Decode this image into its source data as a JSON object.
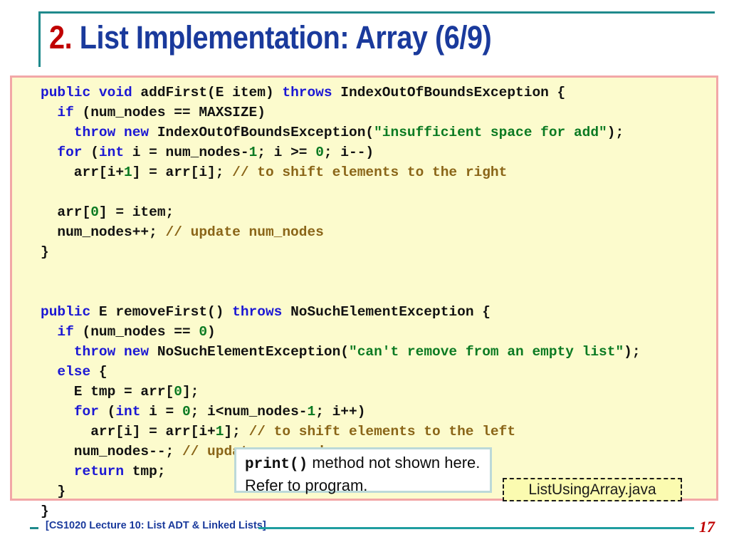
{
  "slide": {
    "title_number": "2.",
    "title_rest": " List Implementation: Array (6/9)",
    "title_accent_color": "#c00000",
    "title_color": "#1a3a9c",
    "title_border_color": "#1f8a8c",
    "page_number": "17"
  },
  "footer": {
    "text": "[CS1020 Lecture 10: List ADT & Linked Lists]",
    "rule_color": "#1f9da0",
    "text_color": "#1a3a9c"
  },
  "code_panel": {
    "background_color": "#fcfbcd",
    "border_color": "#f2a7a7",
    "language": "java",
    "syntax_colors": {
      "keyword": "#1b17d4",
      "number": "#0b7a22",
      "string": "#0b7a22",
      "comment": "#8a6518",
      "plain": "#111111"
    },
    "lines": [
      [
        {
          "t": "kw",
          "s": "public void"
        },
        {
          "t": "pln",
          "s": " addFirst(E item) "
        },
        {
          "t": "kw",
          "s": "throws"
        },
        {
          "t": "pln",
          "s": " IndexOutOfBoundsException {"
        }
      ],
      [
        {
          "t": "pln",
          "s": "  "
        },
        {
          "t": "kw",
          "s": "if"
        },
        {
          "t": "pln",
          "s": " (num_nodes == MAXSIZE)"
        }
      ],
      [
        {
          "t": "pln",
          "s": "    "
        },
        {
          "t": "kw",
          "s": "throw new"
        },
        {
          "t": "pln",
          "s": " IndexOutOfBoundsException("
        },
        {
          "t": "str",
          "s": "\"insufficient space for add\""
        },
        {
          "t": "pln",
          "s": ");"
        }
      ],
      [
        {
          "t": "pln",
          "s": "  "
        },
        {
          "t": "kw",
          "s": "for"
        },
        {
          "t": "pln",
          "s": " ("
        },
        {
          "t": "kw",
          "s": "int"
        },
        {
          "t": "pln",
          "s": " i = num_nodes-"
        },
        {
          "t": "num",
          "s": "1"
        },
        {
          "t": "pln",
          "s": "; i >= "
        },
        {
          "t": "num",
          "s": "0"
        },
        {
          "t": "pln",
          "s": "; i--)"
        }
      ],
      [
        {
          "t": "pln",
          "s": "    arr[i+"
        },
        {
          "t": "num",
          "s": "1"
        },
        {
          "t": "pln",
          "s": "] = arr[i]; "
        },
        {
          "t": "cmt",
          "s": "// to shift elements to the right"
        }
      ],
      [],
      [
        {
          "t": "pln",
          "s": "  arr["
        },
        {
          "t": "num",
          "s": "0"
        },
        {
          "t": "pln",
          "s": "] = item;"
        }
      ],
      [
        {
          "t": "pln",
          "s": "  num_nodes++; "
        },
        {
          "t": "cmt",
          "s": "// update num_nodes"
        }
      ],
      [
        {
          "t": "pln",
          "s": "}"
        }
      ],
      [],
      [],
      [
        {
          "t": "kw",
          "s": "public"
        },
        {
          "t": "pln",
          "s": " E removeFirst() "
        },
        {
          "t": "kw",
          "s": "throws"
        },
        {
          "t": "pln",
          "s": " NoSuchElementException {"
        }
      ],
      [
        {
          "t": "pln",
          "s": "  "
        },
        {
          "t": "kw",
          "s": "if"
        },
        {
          "t": "pln",
          "s": " (num_nodes == "
        },
        {
          "t": "num",
          "s": "0"
        },
        {
          "t": "pln",
          "s": ")"
        }
      ],
      [
        {
          "t": "pln",
          "s": "    "
        },
        {
          "t": "kw",
          "s": "throw new"
        },
        {
          "t": "pln",
          "s": " NoSuchElementException("
        },
        {
          "t": "str",
          "s": "\"can't remove from an empty list\""
        },
        {
          "t": "pln",
          "s": ");"
        }
      ],
      [
        {
          "t": "pln",
          "s": "  "
        },
        {
          "t": "kw",
          "s": "else"
        },
        {
          "t": "pln",
          "s": " {"
        }
      ],
      [
        {
          "t": "pln",
          "s": "    E tmp = arr["
        },
        {
          "t": "num",
          "s": "0"
        },
        {
          "t": "pln",
          "s": "];"
        }
      ],
      [
        {
          "t": "pln",
          "s": "    "
        },
        {
          "t": "kw",
          "s": "for"
        },
        {
          "t": "pln",
          "s": " ("
        },
        {
          "t": "kw",
          "s": "int"
        },
        {
          "t": "pln",
          "s": " i = "
        },
        {
          "t": "num",
          "s": "0"
        },
        {
          "t": "pln",
          "s": "; i<num_nodes-"
        },
        {
          "t": "num",
          "s": "1"
        },
        {
          "t": "pln",
          "s": "; i++)"
        }
      ],
      [
        {
          "t": "pln",
          "s": "      arr[i] = arr[i+"
        },
        {
          "t": "num",
          "s": "1"
        },
        {
          "t": "pln",
          "s": "]; "
        },
        {
          "t": "cmt",
          "s": "// to shift elements to the left"
        }
      ],
      [
        {
          "t": "pln",
          "s": "    num_nodes--; "
        },
        {
          "t": "cmt",
          "s": "// update num_nodes"
        }
      ],
      [
        {
          "t": "pln",
          "s": "    "
        },
        {
          "t": "kw",
          "s": "return"
        },
        {
          "t": "pln",
          "s": " tmp;"
        }
      ],
      [
        {
          "t": "pln",
          "s": "  }"
        }
      ],
      [
        {
          "t": "pln",
          "s": "}"
        }
      ]
    ]
  },
  "print_note": {
    "mono_text": "print()",
    "rest_text": " method not shown here. Refer to program.",
    "border_color": "#bcd9d9",
    "background_color": "#ffffff"
  },
  "file_tag": {
    "label": "ListUsingArray.java",
    "background_color": "#fbfbb0",
    "border_color": "#1a1a1a"
  }
}
